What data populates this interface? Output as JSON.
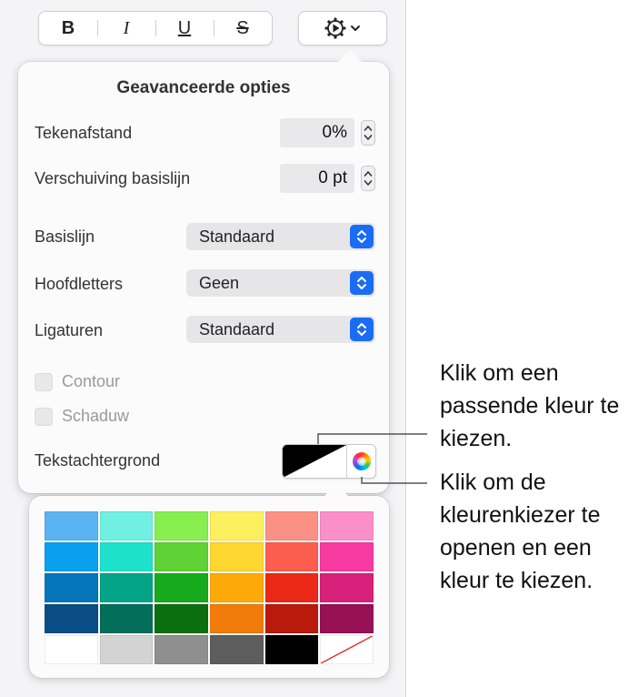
{
  "toolbar": {
    "bold_label": "B",
    "italic_label": "I",
    "underline_label": "U",
    "strikethrough_label": "S",
    "gear_icon": "gear-icon",
    "chevron_icon": "chevron-down-icon"
  },
  "popover": {
    "title": "Geavanceerde opties",
    "character_spacing": {
      "label": "Tekenafstand",
      "value": "0%"
    },
    "baseline_shift": {
      "label": "Verschuiving basislijn",
      "value": "0 pt"
    },
    "baseline": {
      "label": "Basislijn",
      "value": "Standaard"
    },
    "capitalization": {
      "label": "Hoofdletters",
      "value": "Geen"
    },
    "ligatures": {
      "label": "Ligaturen",
      "value": "Standaard"
    },
    "outline": {
      "label": "Contour",
      "checked": false
    },
    "shadow": {
      "label": "Schaduw",
      "checked": false
    },
    "text_background": {
      "label": "Tekstachtergrond"
    }
  },
  "palette": {
    "colors": [
      "#5ab3f2",
      "#6ff0e3",
      "#86ee4e",
      "#fdf05e",
      "#fb9085",
      "#fb8fc9",
      "#0aa0f0",
      "#1de2cb",
      "#5fd236",
      "#fed730",
      "#fb5e4e",
      "#f63aa0",
      "#0675ba",
      "#03a487",
      "#16aa1c",
      "#fdaa08",
      "#ec2816",
      "#d8217b",
      "#0b4e86",
      "#036e5a",
      "#0b6f0f",
      "#f27c0a",
      "#b91a0c",
      "#961155",
      "#ffffff",
      "#d3d3d3",
      "#8f8f8f",
      "#5d5d5d",
      "#000000",
      "none"
    ]
  },
  "callouts": {
    "first": "Klik om een passende kleur te kiezen.",
    "second": "Klik om de kleurenkiezer te openen en een kleur te kiezen."
  },
  "colors": {
    "accent": "#1a6cf3"
  }
}
